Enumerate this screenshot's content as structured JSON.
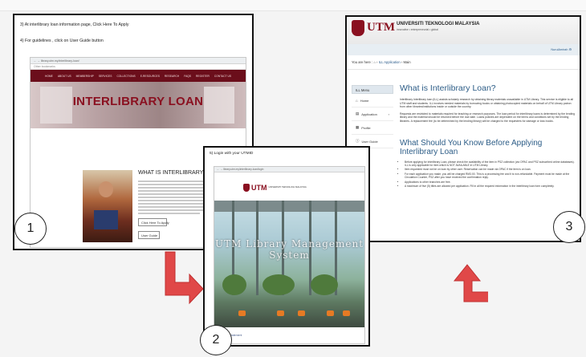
{
  "step1": {
    "instruction_1": "3) At interlibrary loan information page, Click Here To Apply",
    "instruction_2": "4) For guidelines , click on User Guide button",
    "browser_url": "library.utm.my/interlibrary-loan/",
    "browser_menu": "Other bookmarks",
    "nav_items": [
      "HOME",
      "ABOUT US",
      "MEMBERSHIP",
      "SERVICES",
      "COLLECTIONS",
      "E-RESOURCES",
      "RESEARCH",
      "FAQS",
      "REGISTER",
      "CONTACT US"
    ],
    "hero_title": "INTERLIBRARY LOAN",
    "what_title": "WHAT IS INTERLIBRARY LOAN?",
    "apply_button": "Click Here To Apply",
    "guide_button": "User Guide",
    "step_number": "1"
  },
  "step2": {
    "instruction": "5) Login with your UTMID",
    "browser_url": "library.utm.my/interlibrary-loan/login",
    "logo_text": "UTM",
    "logo_sub": "UNIVERSITI TEKNOLOGI MALAYSIA",
    "banner_text": "UTM Library Management System",
    "footer_link": "Privacy Statement",
    "step_number": "2"
  },
  "step3": {
    "logo_text": "UTM",
    "university": "UNIVERSITI TEKNOLOGI MALAYSIA",
    "tagline": "innovative • entrepreneurial • global",
    "user": "NurulAmirah",
    "crumb_prefix": "You are here :",
    "crumb_link": "ILL Application",
    "crumb_current": "Main",
    "menu_head": "ILL Menu",
    "menu_items": [
      {
        "icon": "home-icon",
        "glyph": "⌂",
        "label": "Home"
      },
      {
        "icon": "document-icon",
        "glyph": "▤",
        "label": "Application"
      },
      {
        "icon": "profile-icon",
        "glyph": "▦",
        "label": "Profile"
      },
      {
        "icon": "info-icon",
        "glyph": "ⓘ",
        "label": "User Guide"
      }
    ],
    "heading_1": "What is Interlibrary Loan?",
    "para_1": "Interlibrary Interlibrary loan (ILL) assists scholarly research by obtaining library materials unavailable in UTM Library. This service is eligible to all UTM staff and students. ILL involves needed materials by borrowing books or obtaining photocopied materials on behalf of UTM Library patron from other libraries/institutions inside or outside the country.",
    "para_2": "Requests are restricted to materials required for teaching or research purposes. The loan period for interlibrary loans is determined by the lending library and the material should be returned before the due date. Loans policies are dependent on the terms and conditions set by the lending libraries. A replacement fee (to be determined by the lending library) will be charged to the requesters for damage or loss books.",
    "heading_2": "What Should You Know Before Applying Interlibrary Loan",
    "bullets": [
      "Before applying for Interlibrary Loan, please check the availability of the item in PSZ collection (via OPAC and PSZ subscribed online databases). ILL is only applicable for item which is NOT AVAILABLE in UTM Library.",
      "Item requested must not be on loan by other user. Reservation can be made via OPAC if the item is on loan.",
      "For each application you made, you will be charged RM3.00. This is a processing fee and it is non-refundable. Payment must be made at the Circulation Counter, PSZ after you have received the confirmation reply.",
      "Applications to other branches are free.",
      "A maximum of five (5) titles are allowed per application. Fill in all the required information in the interlibrary loan form completely."
    ],
    "step_number": "3"
  },
  "colors": {
    "utm_maroon": "#8a1020",
    "heading_blue": "#2d5d87",
    "arrow_red": "#e04848"
  }
}
